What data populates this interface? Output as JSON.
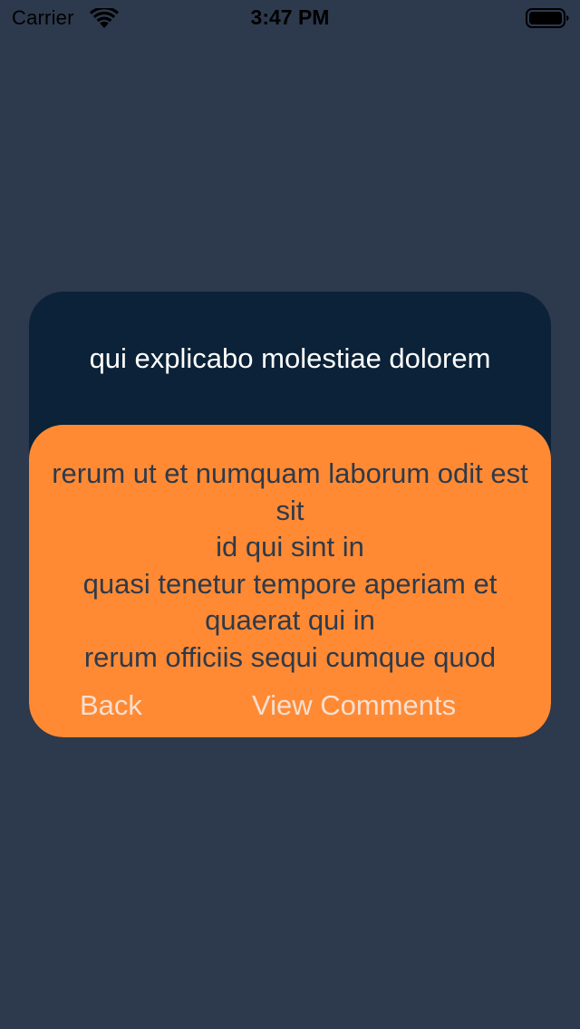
{
  "status_bar": {
    "carrier": "Carrier",
    "time": "3:47 PM",
    "wifi_icon": "wifi-icon",
    "battery_icon": "battery-full-icon"
  },
  "post": {
    "title": "qui explicabo molestiae dolorem",
    "body": "rerum ut et numquam laborum odit est sit\nid qui sint in\nquasi tenetur tempore aperiam et quaerat qui in\nrerum officiis sequi cumque quod",
    "back_label": "Back",
    "comments_label": "View Comments"
  },
  "colors": {
    "background": "#2d394c",
    "card_header": "#0b2238",
    "card_body": "#ff8a33",
    "body_text": "#2e3a4b",
    "button_text": "#f5dfd2"
  }
}
